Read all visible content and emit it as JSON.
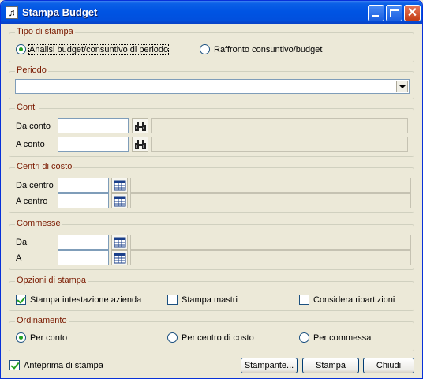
{
  "window": {
    "title": "Stampa Budget",
    "app_icon": "music-note-icon"
  },
  "tipo_stampa": {
    "legend": "Tipo di stampa",
    "options": [
      {
        "label": "Analisi budget/consuntivo di periodo",
        "selected": true
      },
      {
        "label": "Raffronto consuntivo/budget",
        "selected": false
      }
    ]
  },
  "periodo": {
    "legend": "Periodo",
    "value": ""
  },
  "conti": {
    "legend": "Conti",
    "da_label": "Da conto",
    "a_label": "A conto",
    "da_value": "",
    "a_value": "",
    "search_icon": "binoculars-icon"
  },
  "centri": {
    "legend": "Centri di costo",
    "da_label": "Da centro",
    "a_label": "A centro",
    "da_value": "",
    "a_value": "",
    "lookup_icon": "table-lookup-icon"
  },
  "commesse": {
    "legend": "Commesse",
    "da_label": "Da",
    "a_label": "A",
    "da_value": "",
    "a_value": ""
  },
  "opzioni": {
    "legend": "Opzioni di stampa",
    "items": [
      {
        "label": "Stampa intestazione azienda",
        "checked": true
      },
      {
        "label": "Stampa mastri",
        "checked": false
      },
      {
        "label": "Considera ripartizioni",
        "checked": false
      }
    ]
  },
  "ordinamento": {
    "legend": "Ordinamento",
    "options": [
      {
        "label": "Per conto",
        "selected": true
      },
      {
        "label": "Per centro di costo",
        "selected": false
      },
      {
        "label": "Per commessa",
        "selected": false
      }
    ]
  },
  "footer": {
    "preview_label": "Anteprima di stampa",
    "preview_checked": true,
    "printer_button": "Stampante...",
    "print_button": "Stampa",
    "close_button": "Chiudi"
  }
}
